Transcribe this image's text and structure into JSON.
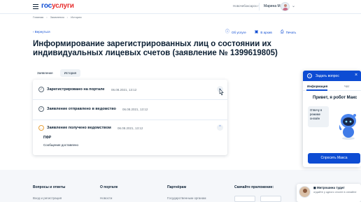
{
  "header": {
    "logo_part1": "гос",
    "logo_part2": "услуги",
    "region": "Новочебоксарск г",
    "user_name": "Марина М."
  },
  "breadcrumbs": [
    "Главная",
    "Заявления",
    "История"
  ],
  "back_label": "Вернуться",
  "actions": [
    {
      "label": "Об услуге",
      "icon": "info-icon"
    },
    {
      "label": "В архив",
      "icon": "archive-icon"
    },
    {
      "label": "Печать",
      "icon": "print-icon"
    }
  ],
  "title": "Информирование зарегистрированных лиц о состоянии их индивидуальных лицевых счетов (заявление № 1399619805)",
  "tabs": [
    {
      "label": "Заявление",
      "active": false
    },
    {
      "label": "История",
      "active": true
    }
  ],
  "history": [
    {
      "label": "Зарегистрировано на портале",
      "date": "06.08.2021, 13:12",
      "status": "done"
    },
    {
      "label": "Заявление отправлено в ведомство",
      "date": "06.08.2021, 13:12",
      "status": "done"
    },
    {
      "label": "Заявление получено ведомством",
      "date": "06.08.2021, 13:12",
      "status": "pending",
      "org": "ПФР",
      "message": "Сообщение доставлено"
    }
  ],
  "footer": {
    "columns": [
      {
        "title": "Вопросы и ответы",
        "link": "Вход и регистрация"
      },
      {
        "title": "О портале",
        "link": "Новости"
      },
      {
        "title": "Партнёрам",
        "link": "Государственным органам"
      },
      {
        "title": "Скачайте приложение:",
        "link": ""
      }
    ]
  },
  "chat": {
    "header_title": "Задать вопрос",
    "tab_info": "Информация",
    "tab_chat": "Чат",
    "greeting": "Привет, я робот Макс",
    "bubble_text": "Отвечу в режиме онлайн",
    "button_label": "Спросить Макса"
  },
  "notification": {
    "title": "Митрошина тудит",
    "text": "отдайте у одного стоите в онлайне"
  },
  "colors": {
    "accent": "#0d4cd3",
    "brand_red": "#e62e2e",
    "pending": "#e8a33d"
  }
}
